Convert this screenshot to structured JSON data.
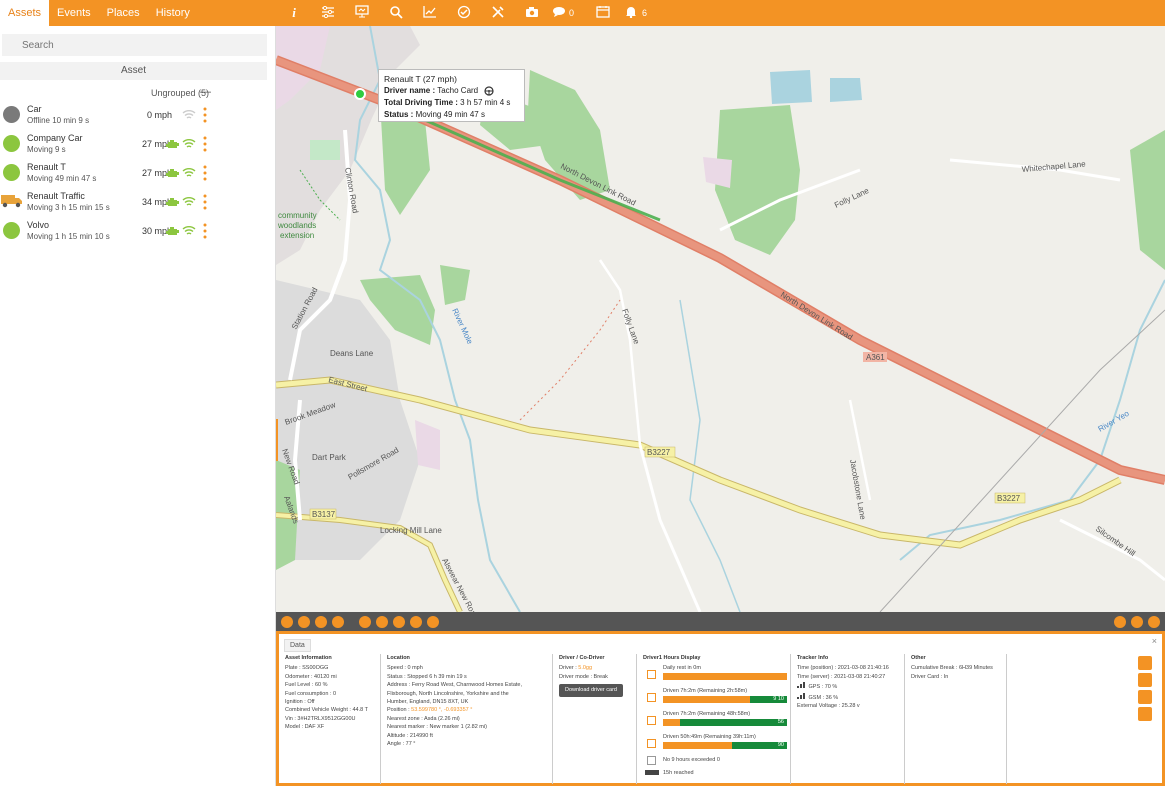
{
  "nav": {
    "tabs": [
      "Assets",
      "Events",
      "Places",
      "History"
    ]
  },
  "toolbar": {
    "messages_count": "0",
    "alerts_count": "6"
  },
  "sidebar": {
    "search_placeholder": "Search",
    "asset_header": "Asset",
    "group_label": "Ungrouped (5)",
    "collapse_symbol": "—",
    "assets": [
      {
        "name": "Car",
        "status": "Offline 10 min 9 s",
        "speed": "0 mph",
        "color": "#7a7a7a"
      },
      {
        "name": "Company Car",
        "status": "Moving 9 s",
        "speed": "27 mph",
        "color": "#8cc63f"
      },
      {
        "name": "Renault T",
        "status": "Moving 49 min 47 s",
        "speed": "27 mph",
        "color": "#8cc63f"
      },
      {
        "name": "Renault Traffic",
        "status": "Moving 3 h 15 min 15 s",
        "speed": "34 mph",
        "color": "#e8a33a"
      },
      {
        "name": "Volvo",
        "status": "Moving 1 h 15 min 10 s",
        "speed": "30 mph",
        "color": "#8cc63f"
      }
    ]
  },
  "map": {
    "road_labels": {
      "north_devon_1": "North Devon Link Road",
      "north_devon_2": "North Devon Link Road",
      "a361": "A361",
      "b3227_1": "B3227",
      "b3227_2": "B3227",
      "b3137": "B3137",
      "east_street": "East Street",
      "station_road": "Station Road",
      "new_road": "New Road",
      "folly_lane_1": "Folly Lane",
      "folly_lane_2": "Folly Lane",
      "whitechapel_lane": "Whitechapel Lane",
      "jacobstone_lane": "Jacobstone Lane",
      "silcombe_hill": "Silcombe Hill",
      "river_mole": "River Mole",
      "river_yeo": "River Yeo",
      "brook_meadow": "Brook Meadow",
      "dart_park": "Dart Park",
      "deans_lane": "Deans Lane",
      "alswear_new_road": "Alswear New Road",
      "locking_mill_lane": "Locking Mill Lane",
      "pollsmore_road": "Pollsmore Road",
      "clinton_road": "Clinton Road",
      "community": "community",
      "woodlands": "woodlands",
      "extension": "extension",
      "aalands": "Aalands"
    },
    "popup": {
      "title": "Renault T (27 mph)",
      "driver_label": "Driver name :",
      "driver_value": "Tacho Card",
      "driving_label": "Total Driving Time :",
      "driving_value": "3 h 57 min 4 s",
      "status_label": "Status :",
      "status_value": "Moving 49 min 47 s"
    }
  },
  "detail": {
    "tab": "Data",
    "close": "×",
    "asset_info": {
      "title": "Asset Information",
      "lines": [
        "Plate : SS00OGG",
        "Odometer : 40120 mi",
        "Fuel Level : 60 %",
        "Fuel consumption : 0",
        "Ignition : Off",
        "Combined Vehicle Weight : 44.8 T",
        "Vin : 3#H2TRLX9512GG00U",
        "Model : DAF XF"
      ]
    },
    "location": {
      "title": "Location",
      "lines": [
        "Speed : 0 mph",
        "Status : Stopped 6 h 39 min 19 s",
        "Address : Ferry Road West, Charnwood Homes Estate,",
        "Flixborough, North Lincolnshire, Yorkshire and the",
        "Humber, England, DN15 8XT, UK"
      ],
      "position_label": "Position :",
      "position_value": "53.599780 °, -0.693357 °",
      "lines2": [
        "Nearest zone : Asda (2.26 mi)",
        "Nearest marker : New marker 1 (2.82 mi)",
        "Altitude : 214990 ft",
        "Angle : 77 °"
      ]
    },
    "driver": {
      "title": "Driver / Co-Driver",
      "driver_label": "Driver :",
      "driver_value": "5.0gg",
      "mode": "Driver mode : Break",
      "download": "Download driver card"
    },
    "hours": {
      "title": "Driver1 Hours Display",
      "rows": [
        {
          "label": "Daily rest in 0m",
          "value": ""
        },
        {
          "label": "Driven 7h:2m (Remaining 2h:58m)",
          "value": "9 10"
        },
        {
          "label": "Driven 7h:2m (Remaining 48h:58m)",
          "value": "56"
        },
        {
          "label": "Driven 50h:49m (Remaining 39h:11m)",
          "value": "90"
        }
      ],
      "exceeded": "No 9 hours exceeded 0",
      "reached": "15h reached"
    },
    "tracker": {
      "title": "Tracker Info",
      "lines": [
        "Time (position) : 2021-03-08 21:40:16",
        "Time (server) : 2021-03-08 21:40:27"
      ],
      "gps": "GPS : 70 %",
      "gsm": "GSM : 36 %",
      "voltage": "External Voltage : 25.28 v"
    },
    "other": {
      "title": "Other",
      "lines": [
        "Cumulative Break : 6H39 Minutes",
        "Driver Card : In"
      ]
    }
  }
}
